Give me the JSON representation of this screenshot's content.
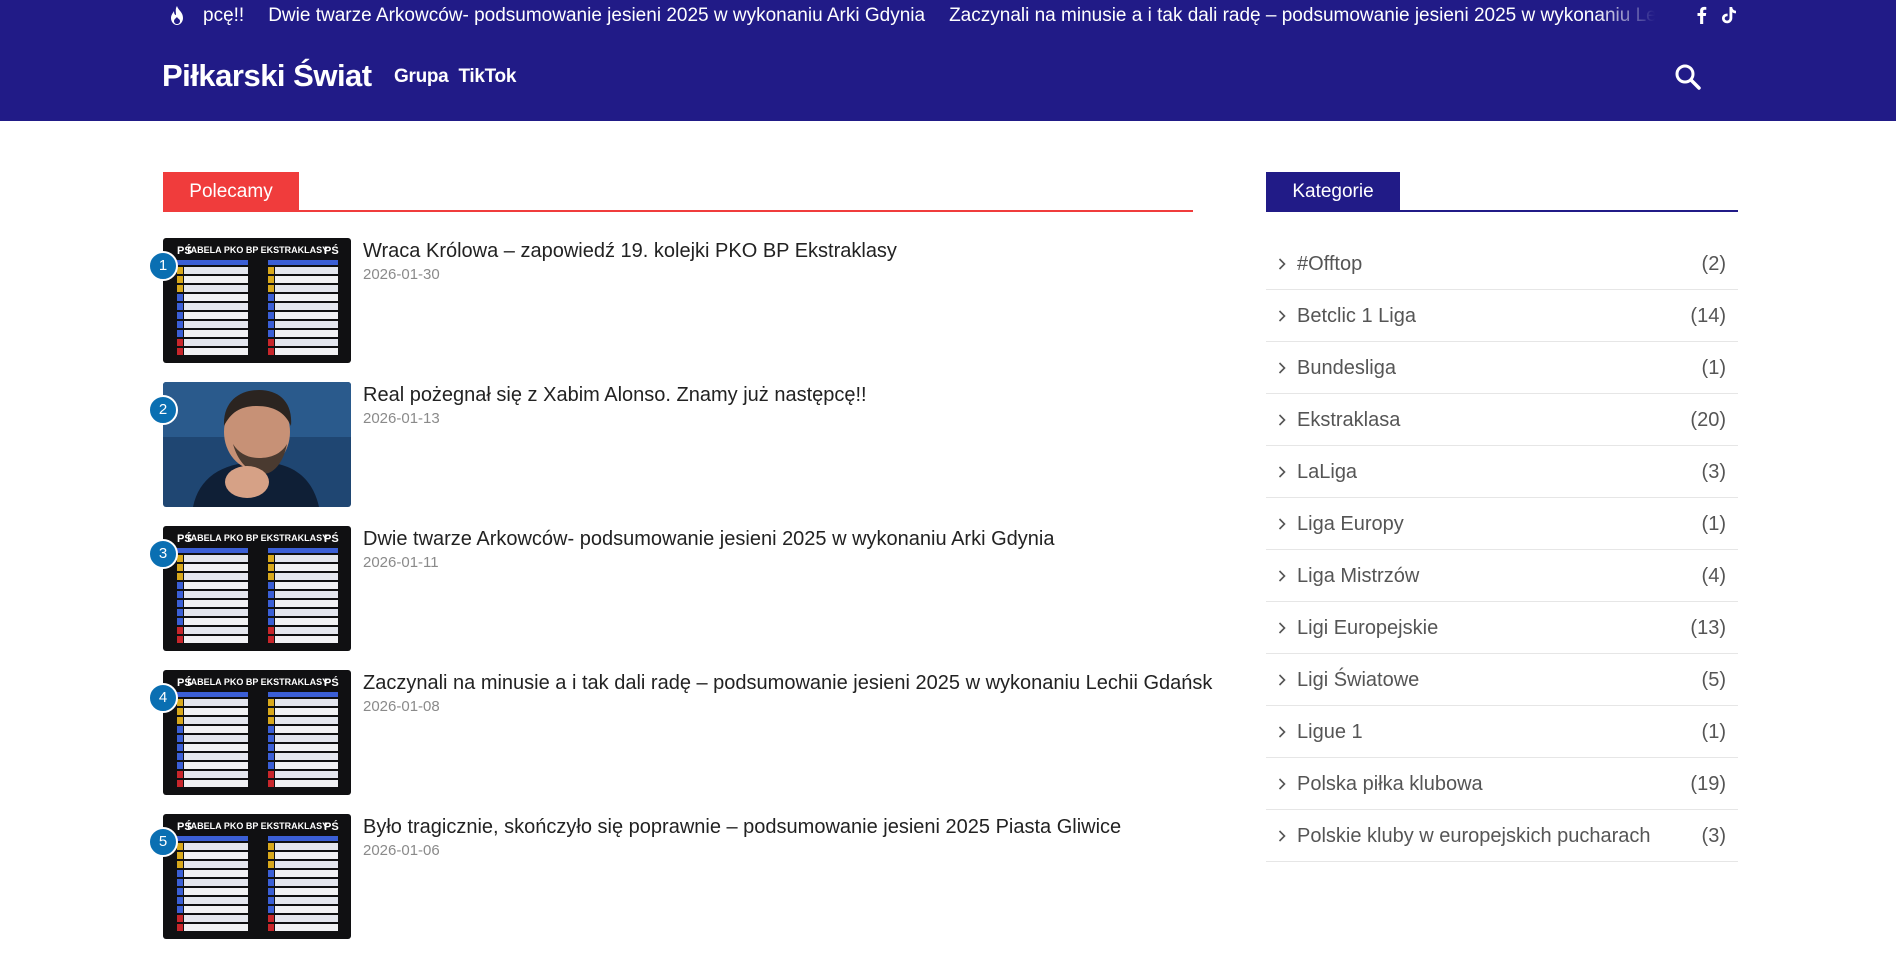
{
  "colors": {
    "header_bg": "#211b87",
    "accent_red": "#f03c3c",
    "accent_navy": "#211b87",
    "badge_blue": "#0a6fb2"
  },
  "ticker": {
    "icon": "fire-icon",
    "items": [
      "pcę!!",
      "Dwie twarze Arkowców- podsumowanie jesieni 2025 w wykonaniu Arki Gdynia",
      "Zaczynali na minusie a i tak dali radę – podsumowanie jesieni 2025 w wykonaniu Lechii Gdańsk"
    ]
  },
  "social": [
    {
      "icon": "facebook-icon"
    },
    {
      "icon": "tiktok-icon"
    }
  ],
  "header": {
    "logo": "Piłkarski Świat",
    "nav": [
      {
        "label": "Grupa"
      },
      {
        "label": "TikTok"
      }
    ],
    "search_icon": "search-icon"
  },
  "recommended": {
    "title": "Polecamy",
    "items": [
      {
        "rank": "1",
        "title": "Wraca Królowa – zapowiedź 19. kolejki PKO BP Ekstraklasy",
        "date": "2026-01-30",
        "thumb": "table",
        "thumb_caption": "TABELA PKO BP EKSTRAKLASY",
        "thumb_logo": "PŚ"
      },
      {
        "rank": "2",
        "title": "Real pożegnał się z Xabim Alonso. Znamy już następcę!!",
        "date": "2026-01-13",
        "thumb": "photo"
      },
      {
        "rank": "3",
        "title": "Dwie twarze Arkowców- podsumowanie jesieni 2025 w wykonaniu Arki Gdynia",
        "date": "2026-01-11",
        "thumb": "table",
        "thumb_caption": "TABELA PKO BP EKSTRAKLASY",
        "thumb_logo": "PŚ"
      },
      {
        "rank": "4",
        "title": "Zaczynali na minusie a i tak dali radę – podsumowanie jesieni 2025 w wykonaniu Lechii Gdańsk",
        "date": "2026-01-08",
        "thumb": "table",
        "thumb_caption": "TABELA PKO BP EKSTRAKLASY",
        "thumb_logo": "PŚ"
      },
      {
        "rank": "5",
        "title": "Było tragicznie, skończyło się poprawnie – podsumowanie jesieni 2025 Piasta Gliwice",
        "date": "2026-01-06",
        "thumb": "table",
        "thumb_caption": "TABELA PKO BP EKSTRAKLASY",
        "thumb_logo": "PŚ"
      }
    ]
  },
  "categories": {
    "title": "Kategorie",
    "items": [
      {
        "name": "#Offtop",
        "count": "(2)"
      },
      {
        "name": "Betclic 1 Liga",
        "count": "(14)"
      },
      {
        "name": "Bundesliga",
        "count": "(1)"
      },
      {
        "name": "Ekstraklasa",
        "count": "(20)"
      },
      {
        "name": "LaLiga",
        "count": "(3)"
      },
      {
        "name": "Liga Europy",
        "count": "(1)"
      },
      {
        "name": "Liga Mistrzów",
        "count": "(4)"
      },
      {
        "name": "Ligi Europejskie",
        "count": "(13)"
      },
      {
        "name": "Ligi Światowe",
        "count": "(5)"
      },
      {
        "name": "Ligue 1",
        "count": "(1)"
      },
      {
        "name": "Polska piłka klubowa",
        "count": "(19)"
      },
      {
        "name": "Polskie kluby w europejskich pucharach",
        "count": "(3)"
      }
    ]
  }
}
